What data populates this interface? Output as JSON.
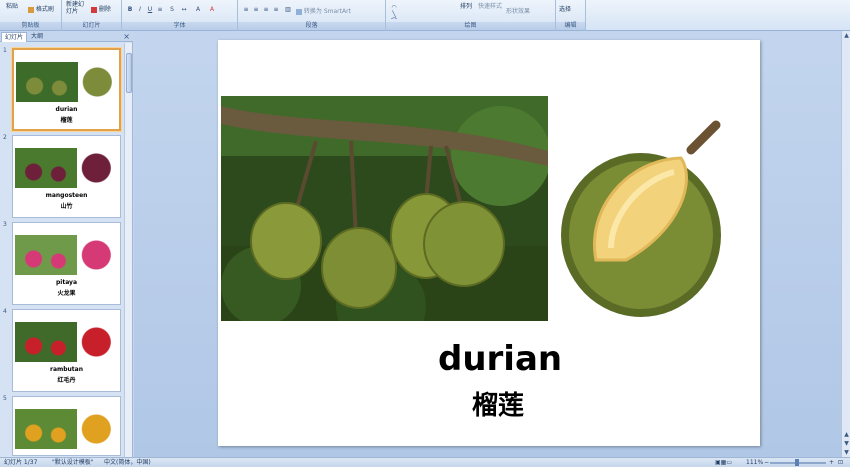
{
  "ribbon": {
    "paste_label": "粘贴",
    "format_painter_label": "格式刷",
    "new_slide_label": "新建幻灯片",
    "delete_label": "删除",
    "convert_smartart_label": "转换为 SmartArt",
    "arrange_label": "排列",
    "quick_styles_label": "快速样式",
    "shape_effects_label": "形状效果",
    "select_label": "选择",
    "groups": [
      "剪贴板",
      "幻灯片",
      "字体",
      "段落",
      "绘图",
      "编辑"
    ]
  },
  "leftpane": {
    "tabs": [
      "幻灯片",
      "大纲"
    ],
    "close_icon": "×",
    "slides": [
      {
        "num": "1",
        "en": "durian",
        "zh": "榴莲",
        "photo_color": "#3d6b2a",
        "fruit_color": "#7d8c3a"
      },
      {
        "num": "2",
        "en": "mangosteen",
        "zh": "山竹",
        "photo_color": "#4a7a2e",
        "fruit_color": "#6e1f3a"
      },
      {
        "num": "3",
        "en": "pitaya",
        "zh": "火龙果",
        "photo_color": "#6f9a4a",
        "fruit_color": "#d63a76"
      },
      {
        "num": "4",
        "en": "rambutan",
        "zh": "红毛丹",
        "photo_color": "#3f6a2a",
        "fruit_color": "#c8202a"
      },
      {
        "num": "5",
        "en": "",
        "zh": "",
        "photo_color": "#5c8a35",
        "fruit_color": "#e0a020"
      }
    ]
  },
  "slide": {
    "word_en": "durian",
    "word_zh": "榴莲"
  },
  "statusbar": {
    "slide_info": "幻灯片 1/37",
    "theme": "\"默认设计模板\"",
    "language": "中文(简体，中国)",
    "zoom": "111%"
  },
  "colors": {
    "accent": "#e3a24a",
    "ribbon_bg": "#dbe7f6",
    "durian_green": "#6b7d2a",
    "durian_flesh": "#f2d27a"
  }
}
